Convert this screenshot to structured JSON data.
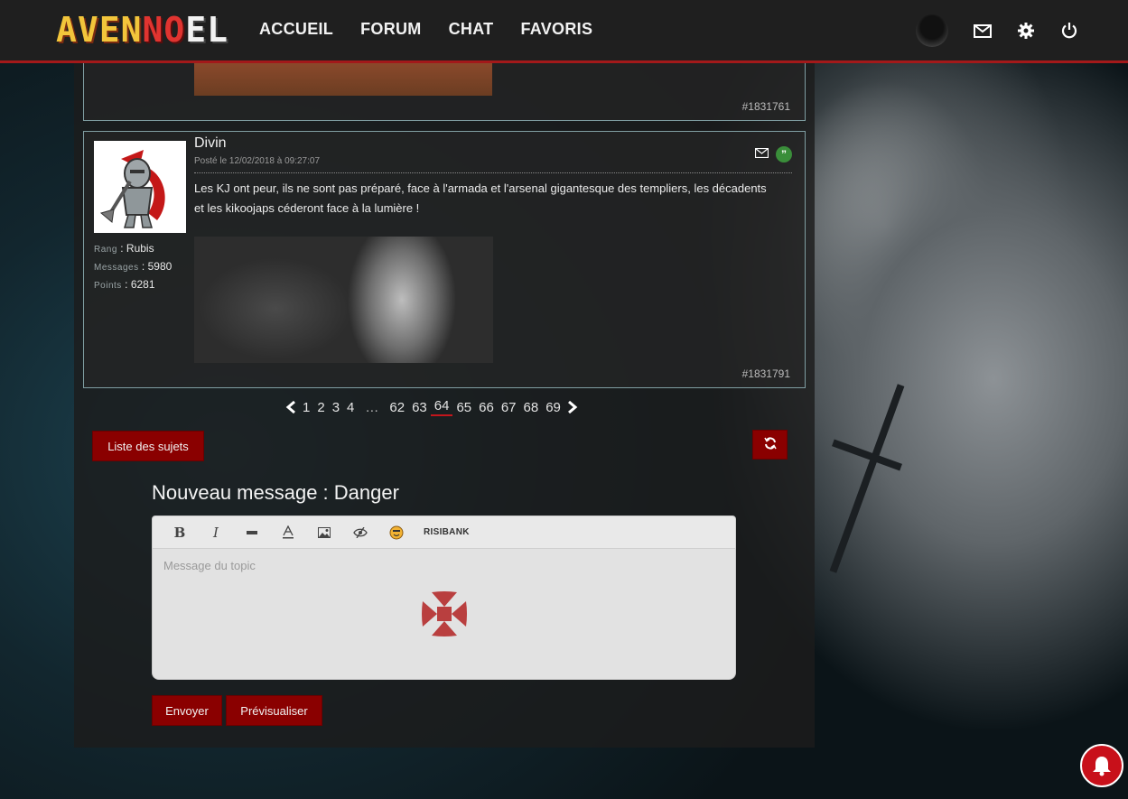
{
  "header": {
    "logo": {
      "part1": "AVEN",
      "part2": "NO",
      "part3": "EL"
    },
    "nav": [
      "ACCUEIL",
      "FORUM",
      "CHAT",
      "FAVORIS"
    ],
    "icons": [
      "user-avatar",
      "mail-icon",
      "gear-icon",
      "power-icon"
    ]
  },
  "previous_post": {
    "id": "#1831761"
  },
  "post": {
    "author": "Divin",
    "date": "Posté le 12/02/2018 à 09:27:07",
    "rank_label": "Rang",
    "rank": "Rubis",
    "messages_label": "Messages",
    "messages": "5980",
    "points_label": "Points",
    "points": "6281",
    "text": "Les KJ ont peur, ils ne sont pas préparé, face à l'armada et l'arsenal gigantesque des templiers, les décadents et les kikoojaps céderont face à la lumière !",
    "id": "#1831791"
  },
  "pagination": {
    "pages_start": [
      "1",
      "2",
      "3",
      "4"
    ],
    "ellipsis": "…",
    "pages_end": [
      "62",
      "63",
      "64",
      "65",
      "66",
      "67",
      "68",
      "69"
    ],
    "current": "64"
  },
  "buttons": {
    "topic_list": "Liste des sujets",
    "send": "Envoyer",
    "preview": "Prévisualiser"
  },
  "editor": {
    "title": "Nouveau message : Danger",
    "placeholder": "Message du topic",
    "risibank_label": "RISIBANK"
  },
  "colors": {
    "accent": "#8a0000",
    "header_border": "#a3191a",
    "quote": "#3a8e3a"
  }
}
